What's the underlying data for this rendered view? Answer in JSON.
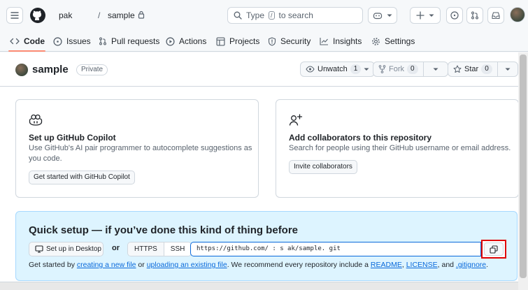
{
  "header": {
    "owner": "pak",
    "separator": "/",
    "repo": "sample",
    "search_placeholder_pre": "Type",
    "search_key": "/",
    "search_placeholder_post": "to search"
  },
  "tabs": [
    {
      "label": "Code",
      "icon": "code-icon"
    },
    {
      "label": "Issues",
      "icon": "issue-icon"
    },
    {
      "label": "Pull requests",
      "icon": "pull-request-icon"
    },
    {
      "label": "Actions",
      "icon": "play-icon"
    },
    {
      "label": "Projects",
      "icon": "table-icon"
    },
    {
      "label": "Security",
      "icon": "shield-icon"
    },
    {
      "label": "Insights",
      "icon": "graph-icon"
    },
    {
      "label": "Settings",
      "icon": "gear-icon"
    }
  ],
  "repo": {
    "name": "sample",
    "visibility": "Private",
    "unwatch_label": "Unwatch",
    "watch_count": "1",
    "fork_label": "Fork",
    "fork_count": "0",
    "star_label": "Star",
    "star_count": "0"
  },
  "cards": {
    "copilot": {
      "title": "Set up GitHub Copilot",
      "description": "Use GitHub's AI pair programmer to autocomplete suggestions as you code.",
      "button": "Get started with GitHub Copilot"
    },
    "collaborators": {
      "title": "Add collaborators to this repository",
      "description": "Search for people using their GitHub username or email address.",
      "button": "Invite collaborators"
    }
  },
  "quick_setup": {
    "title": "Quick setup — if you’ve done this kind of thing before",
    "desktop_button": "Set up in Desktop",
    "or": "or",
    "https": "HTTPS",
    "ssh": "SSH",
    "url": "https://github.com/  :   s   ak/sample. git",
    "text_pre": "Get started by ",
    "link_new_file": "creating a new file",
    "text_or": " or ",
    "link_upload": "uploading an existing file",
    "text_mid": ". We recommend every repository include a ",
    "link_readme": "README",
    "text_comma": ", ",
    "link_license": "LICENSE",
    "text_and": ", and ",
    "link_gitignore": ".gitignore",
    "text_end": "."
  },
  "colors": {
    "accent": "#0969da",
    "tab_underline": "#fd8c73",
    "highlight": "#e00000",
    "quick_bg": "#ddf4ff"
  }
}
